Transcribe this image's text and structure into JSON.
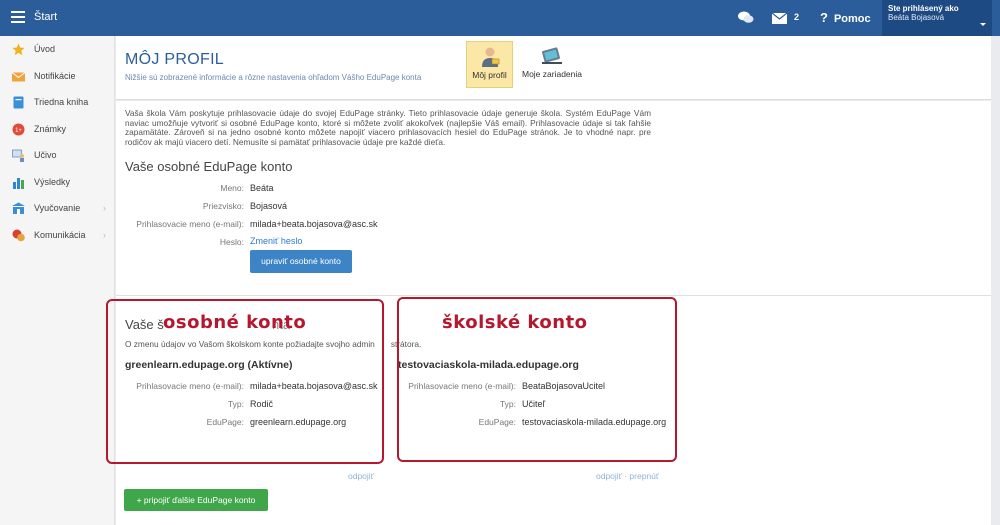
{
  "topbar": {
    "start_label": "Štart",
    "mail_count": "2",
    "help_label": "Pomoc",
    "user_status": "Ste prihlásený ako",
    "user_name": "Beáta Bojasová"
  },
  "sidebar": {
    "items": [
      {
        "label": "Úvod",
        "icon": "star-icon",
        "color": "#f2b21b"
      },
      {
        "label": "Notifikácie",
        "icon": "envelope-icon",
        "color": "#f0a23b"
      },
      {
        "label": "Triedna kniha",
        "icon": "book-icon",
        "color": "#3b8fd8"
      },
      {
        "label": "Známky",
        "icon": "grades-icon",
        "color": "#e04a3a"
      },
      {
        "label": "Učivo",
        "icon": "teacher-icon",
        "color": "#6a8fb8"
      },
      {
        "label": "Výsledky",
        "icon": "bar-chart-icon",
        "color": "#2f86d1"
      },
      {
        "label": "Vyučovanie",
        "icon": "classroom-icon",
        "color": "#3b8fd8"
      },
      {
        "label": "Komunikácia",
        "icon": "chat-people-icon",
        "color": "#d8402f"
      }
    ]
  },
  "header": {
    "title": "MÔJ PROFIL",
    "subtitle": "Nižšie sú zobrazené informácie a rôzne nastavenia ohľadom Vášho EduPage konta",
    "tabs": [
      {
        "label": "Môj profil",
        "active": true
      },
      {
        "label": "Moje zariadenia",
        "active": false
      }
    ]
  },
  "intro_text": "Vaša škola Vám poskytuje prihlasovacie údaje do svojej EduPage stránky. Tieto prihlasovacie údaje generuje škola. Systém EduPage Vám naviac umožňuje vytvoriť si osobné EduPage konto, ktoré si môžete zvoliť akokoľvek (najlepšie Váš email). Prihlasovacie údaje si tak ľahšie zapamätáte. Zároveň si na jedno osobné konto môžete napojiť viacero prihlasovacích hesiel do EduPage stránok. Je to vhodné napr. pre rodičov ak majú viacero detí. Nemusíte si pamätať prihlasovacie údaje pre každé dieťa.",
  "personal": {
    "title": "Vaše osobné EduPage konto",
    "fields": [
      {
        "label": "Meno:",
        "value": "Beáta"
      },
      {
        "label": "Priezvisko:",
        "value": "Bojasová"
      },
      {
        "label": "Prihlasovacie meno (e-mail):",
        "value": "milada+beata.bojasova@asc.sk"
      },
      {
        "label": "Heslo:",
        "value": "Zmeniť heslo"
      }
    ],
    "edit_button": "upraviť osobné konto"
  },
  "school": {
    "title": "Vaše š",
    "title_tail": "ntá",
    "note": "O zmenu údajov vo Vašom školskom konte požiadajte svojho admin",
    "note_tail": "strátora.",
    "accounts": [
      {
        "name": "greenlearn.edupage.org (Aktívne)",
        "fields": [
          {
            "label": "Prihlasovacie meno (e-mail):",
            "value": "milada+beata.bojasova@asc.sk"
          },
          {
            "label": "Typ:",
            "value": "Rodič"
          },
          {
            "label": "EduPage:",
            "value": "greenlearn.edupage.org"
          }
        ],
        "links": "odpojiť"
      },
      {
        "name": "testovaciaskola-milada.edupage.org",
        "fields": [
          {
            "label": "Prihlasovacie meno (e-mail):",
            "value": "BeataBojasovaUcitel"
          },
          {
            "label": "Typ:",
            "value": "Učiteľ"
          },
          {
            "label": "EduPage:",
            "value": "testovaciaskola-milada.edupage.org"
          }
        ],
        "links": "odpojiť · prepnúť"
      }
    ],
    "connect_button": "+ pripojiť ďalšie EduPage konto"
  },
  "annotations": {
    "left": "osobné konto",
    "right": "školské konto",
    "color": "#b5182e"
  }
}
